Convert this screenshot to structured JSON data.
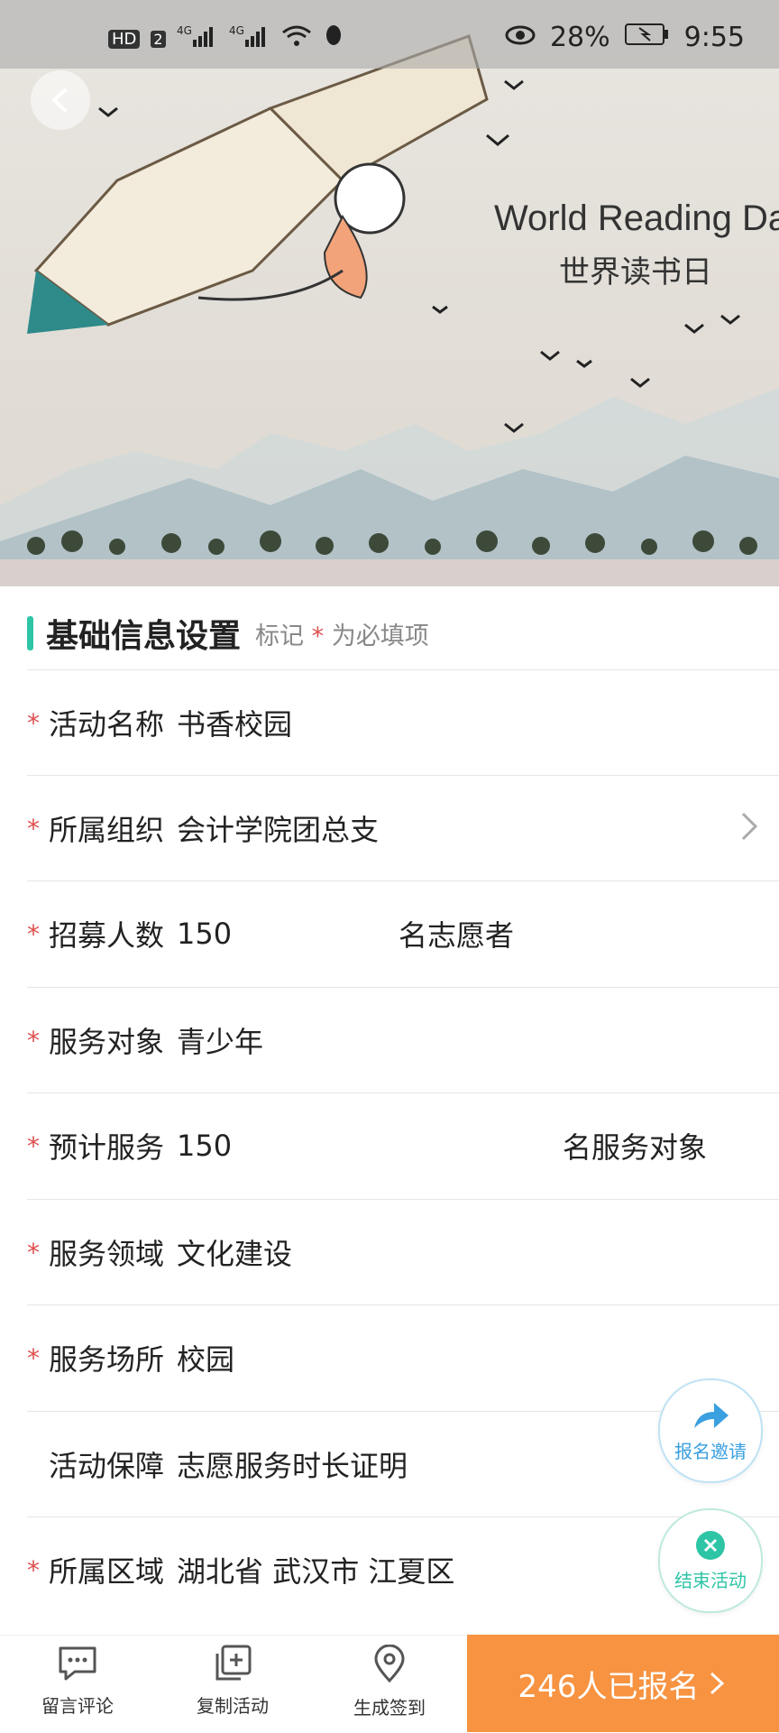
{
  "status_bar": {
    "left_icons": [
      "hd-icon",
      "sim-2-icon",
      "signal-4g-icon",
      "signal-4g-icon",
      "wifi-icon",
      "qq-icon"
    ],
    "battery_percent": "28%",
    "time": "9:55"
  },
  "hero": {
    "title_en": "World Reading Day",
    "title_cn": "世界读书日"
  },
  "form": {
    "section_title": "基础信息设置",
    "note_prefix": "标记",
    "note_star": "*",
    "note_suffix": "为必填项",
    "rows": [
      {
        "required": "*",
        "label": "活动名称",
        "value": "书香校园"
      },
      {
        "required": "*",
        "label": "所属组织",
        "value": "会计学院团总支"
      },
      {
        "required": "*",
        "label": "招募人数",
        "value": "150",
        "unit": "名志愿者"
      },
      {
        "required": "*",
        "label": "服务对象",
        "value": "青少年"
      },
      {
        "required": "*",
        "label": "预计服务",
        "value": "150",
        "unit": "名服务对象"
      },
      {
        "required": "*",
        "label": "服务领域",
        "value": "文化建设"
      },
      {
        "required": "*",
        "label": "服务场所",
        "value": "校园"
      },
      {
        "required": "",
        "label": "活动保障",
        "value": "志愿服务时长证明"
      },
      {
        "required": "*",
        "label": "所属区域",
        "value": "湖北省 武汉市 江夏区"
      }
    ]
  },
  "fabs": {
    "invite_label": "报名邀请",
    "end_label": "结束活动"
  },
  "bottom_bar": {
    "tab_comment": "留言评论",
    "tab_copy": "复制活动",
    "tab_checkin": "生成签到",
    "cta_label": "246人已报名"
  },
  "colors": {
    "accent_green": "#2ec4a6",
    "cta_orange": "#f79341",
    "required_red": "#e05050",
    "invite_blue": "#3aa0e0",
    "end_green": "#2ec4a6"
  }
}
